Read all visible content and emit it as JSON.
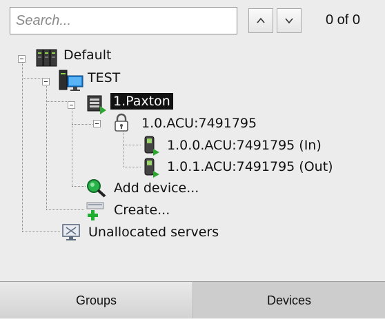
{
  "search": {
    "placeholder": "Search...",
    "value": "",
    "match_count": "0 of 0"
  },
  "tree": {
    "root": {
      "label": "Default",
      "icon": "server-rack-icon",
      "expanded": true
    },
    "server": {
      "label": "TEST",
      "icon": "server-computer-icon",
      "expanded": true
    },
    "device": {
      "label": "1.Paxton",
      "icon": "access-controller-icon",
      "expanded": true,
      "selected": true
    },
    "acu": {
      "label": "1.0.ACU:7491795",
      "icon": "padlock-icon",
      "expanded": true
    },
    "readers": [
      {
        "label": "1.0.0.ACU:7491795 (In)",
        "icon": "card-reader-icon"
      },
      {
        "label": "1.0.1.ACU:7491795 (Out)",
        "icon": "card-reader-icon"
      }
    ],
    "add_device": {
      "label": "Add device...",
      "icon": "magnifier-icon"
    },
    "create": {
      "label": "Create...",
      "icon": "add-plus-icon"
    },
    "unallocated": {
      "label": "Unallocated servers",
      "icon": "monitor-icon"
    }
  },
  "tabs": [
    {
      "label": "Groups",
      "active": false
    },
    {
      "label": "Devices",
      "active": true
    }
  ],
  "colors": {
    "selection_bg": "#111111",
    "panel_bg": "#ececec",
    "active_tab_bg": "#cdcdcd"
  }
}
